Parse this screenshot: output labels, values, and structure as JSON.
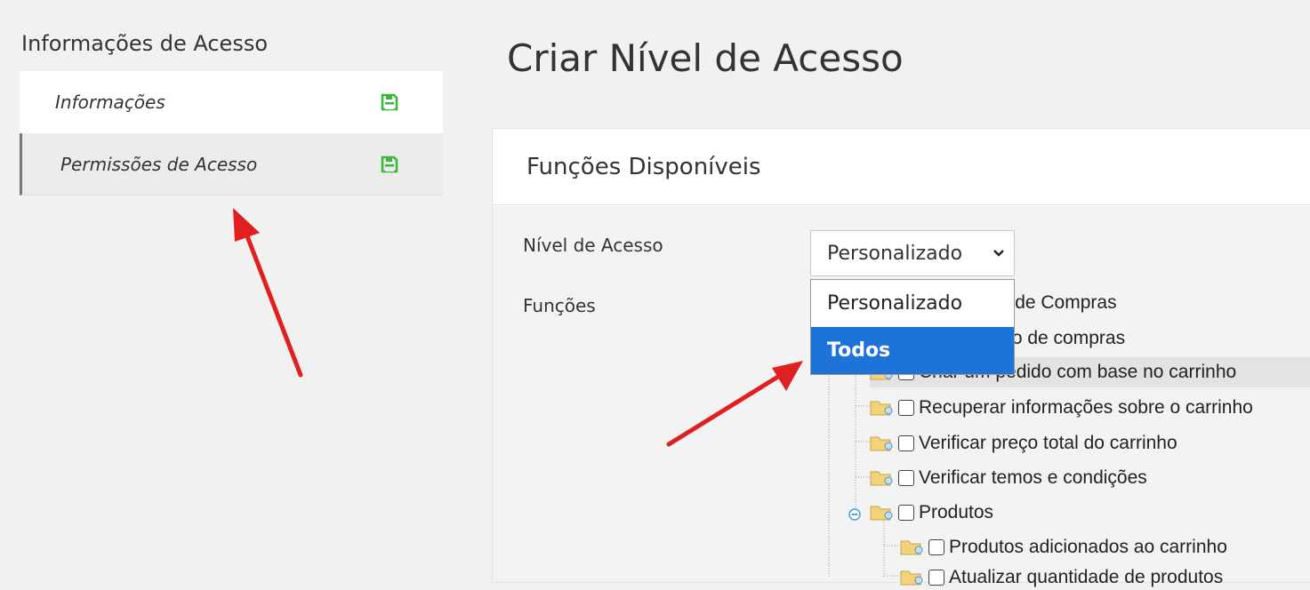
{
  "sidebar": {
    "title": "Informações de Acesso",
    "items": [
      {
        "label": "Informações",
        "icon": "save-icon"
      },
      {
        "label": "Permissões de Acesso",
        "icon": "save-icon"
      }
    ]
  },
  "page": {
    "title": "Criar Nível de Acesso"
  },
  "panel": {
    "title": "Funções Disponíveis",
    "access_level_label": "Nível de Acesso",
    "functions_label": "Funções",
    "select_value": "Personalizado",
    "options": [
      "Personalizado",
      "Todos"
    ],
    "highlighted_option": "Todos"
  },
  "tree": {
    "items": [
      {
        "label": "Lista de Compras"
      },
      {
        "label": "Carrinho de compras"
      },
      {
        "label": "Criar um pedido com base no carrinho"
      },
      {
        "label": "Recuperar informações sobre o carrinho"
      },
      {
        "label": "Verificar preço total do carrinho"
      },
      {
        "label": "Verificar temos e condições"
      },
      {
        "label": "Produtos"
      },
      {
        "label": "Produtos adicionados ao carrinho"
      },
      {
        "label": "Atualizar quantidade de produtos"
      }
    ]
  },
  "colors": {
    "save_icon": "#3cb63c",
    "selected_option": "#1e73d8",
    "arrow": "#e02020"
  }
}
